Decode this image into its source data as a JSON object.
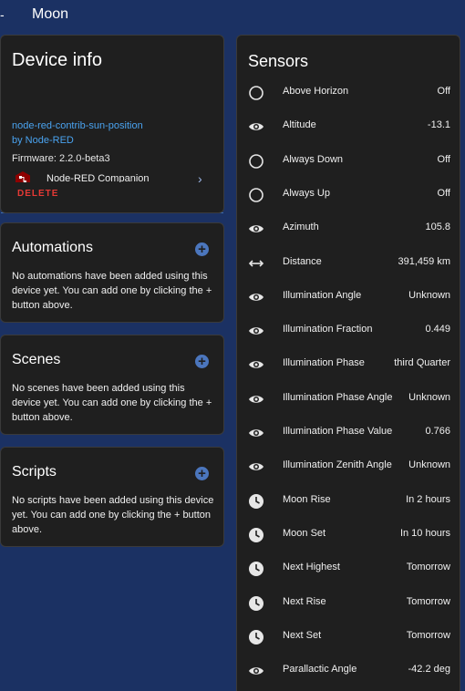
{
  "header": {
    "back_label": "-",
    "title": "Moon"
  },
  "device_info": {
    "title": "Device info",
    "model": "node-red-contrib-sun-position",
    "manufacturer": "by Node-RED",
    "firmware": "Firmware: 2.2.0-beta3",
    "integration": "Node-RED Companion",
    "delete_label": "DELETE"
  },
  "automations": {
    "title": "Automations",
    "body": "No automations have been added using this device yet. You can add one by clicking the + button above."
  },
  "scenes": {
    "title": "Scenes",
    "body": "No scenes have been added using this device yet. You can add one by clicking the + button above."
  },
  "scripts": {
    "title": "Scripts",
    "body": "No scripts have been added using this device yet. You can add one by clicking the + button above."
  },
  "sensors": {
    "title": "Sensors",
    "items": [
      {
        "icon": "circle-outline-icon",
        "name": "Above Horizon",
        "value": "Off"
      },
      {
        "icon": "eye-icon",
        "name": "Altitude",
        "value": "-13.1"
      },
      {
        "icon": "circle-outline-icon",
        "name": "Always Down",
        "value": "Off"
      },
      {
        "icon": "circle-outline-icon",
        "name": "Always Up",
        "value": "Off"
      },
      {
        "icon": "eye-icon",
        "name": "Azimuth",
        "value": "105.8"
      },
      {
        "icon": "arrow-left-right-icon",
        "name": "Distance",
        "value": "391,459 km"
      },
      {
        "icon": "eye-icon",
        "name": "Illumination Angle",
        "value": "Unknown"
      },
      {
        "icon": "eye-icon",
        "name": "Illumination Fraction",
        "value": "0.449"
      },
      {
        "icon": "eye-icon",
        "name": "Illumination Phase",
        "value": "third Quarter"
      },
      {
        "icon": "eye-icon",
        "name": "Illumination Phase Angle",
        "value": "Unknown"
      },
      {
        "icon": "eye-icon",
        "name": "Illumination Phase Value",
        "value": "0.766"
      },
      {
        "icon": "eye-icon",
        "name": "Illumination Zenith Angle",
        "value": "Unknown"
      },
      {
        "icon": "clock-icon",
        "name": "Moon Rise",
        "value": "In 2 hours"
      },
      {
        "icon": "clock-icon",
        "name": "Moon Set",
        "value": "In 10 hours"
      },
      {
        "icon": "clock-icon",
        "name": "Next Highest",
        "value": "Tomorrow"
      },
      {
        "icon": "clock-icon",
        "name": "Next Rise",
        "value": "Tomorrow"
      },
      {
        "icon": "clock-icon",
        "name": "Next Set",
        "value": "Tomorrow"
      },
      {
        "icon": "eye-icon",
        "name": "Parallactic Angle",
        "value": "-42.2 deg"
      }
    ]
  },
  "colors": {
    "background": "#1b3163",
    "card": "#1f1f1f",
    "accent": "#4b76bd",
    "link": "#4aa3f0",
    "danger": "#e53935"
  }
}
